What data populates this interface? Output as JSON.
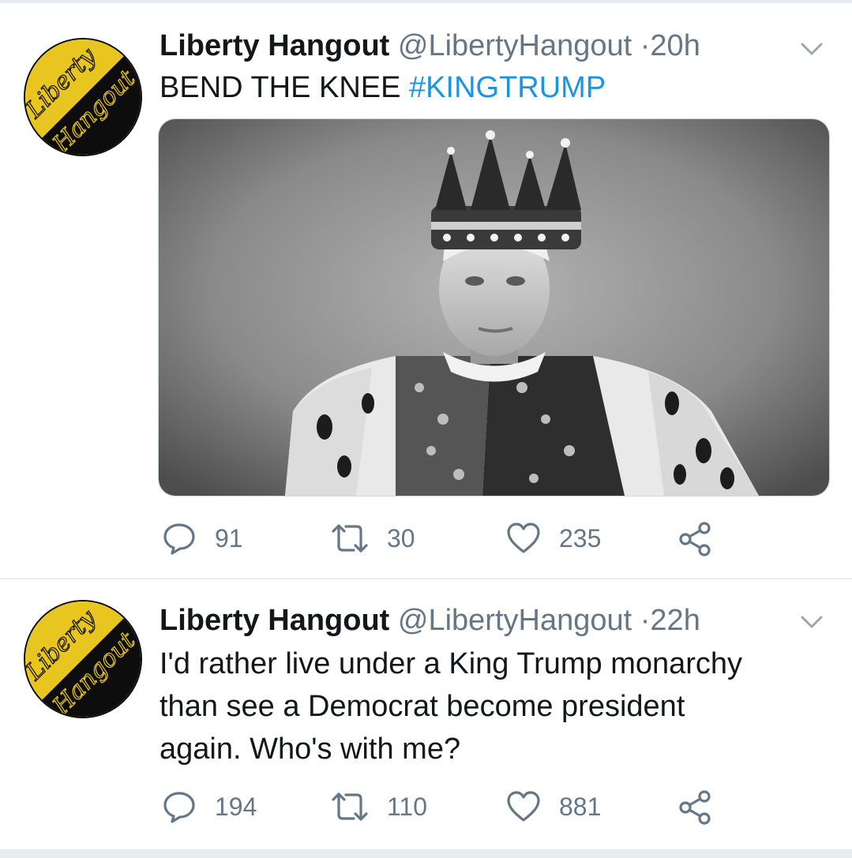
{
  "colors": {
    "text": "#14171a",
    "secondary": "#657786",
    "hashtag": "#1b95e0",
    "divider": "#e6ecf0",
    "avatar_yellow": "#e8c51f",
    "avatar_black": "#0d0d0d"
  },
  "tweets": [
    {
      "author": {
        "name": "Liberty Hangout",
        "handle": "@LibertyHangout",
        "avatar_text_top": "Liberty",
        "avatar_text_bottom": "Hangout"
      },
      "separator": "·",
      "time": "20h",
      "text_prefix": "BEND THE KNEE ",
      "hashtag": "#KINGTRUMP",
      "has_media": true,
      "media_description": "photo",
      "caret_icon": "chevron-down-icon",
      "actions": {
        "reply_icon": "reply-icon",
        "replies": "91",
        "retweet_icon": "retweet-icon",
        "retweets": "30",
        "like_icon": "heart-icon",
        "likes": "235",
        "share_icon": "share-icon"
      }
    },
    {
      "author": {
        "name": "Liberty Hangout",
        "handle": "@LibertyHangout",
        "avatar_text_top": "Liberty",
        "avatar_text_bottom": "Hangout"
      },
      "separator": "·",
      "time": "22h",
      "text_line1": "I'd rather live under a King Trump monarchy",
      "text_line2": "than see a Democrat become president",
      "text_line3": "again. Who's with me?",
      "caret_icon": "chevron-down-icon",
      "actions": {
        "reply_icon": "reply-icon",
        "replies": "194",
        "retweet_icon": "retweet-icon",
        "retweets": "110",
        "like_icon": "heart-icon",
        "likes": "881",
        "share_icon": "share-icon"
      }
    }
  ]
}
